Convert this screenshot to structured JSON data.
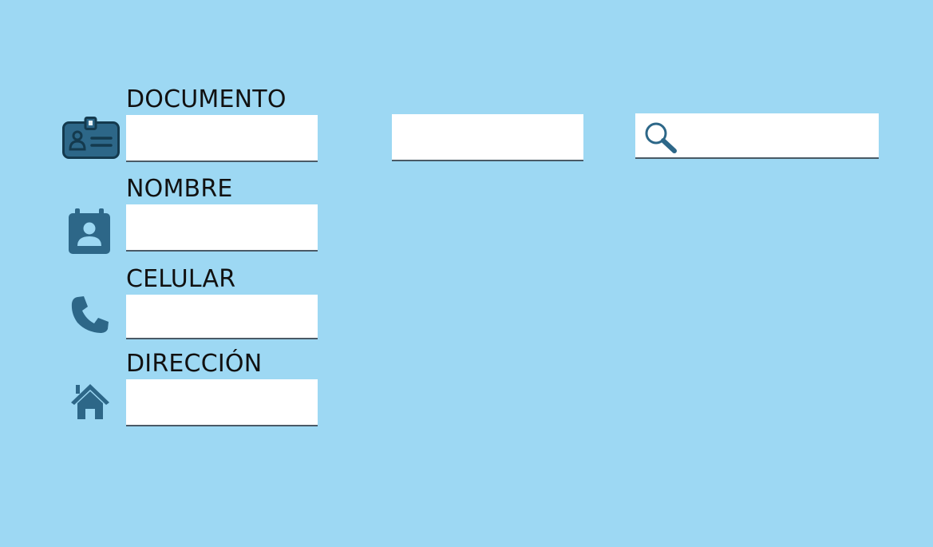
{
  "form": {
    "fields": [
      {
        "id": "documento",
        "label": "DOCUMENTO",
        "value": "",
        "icon": "id-badge-icon"
      },
      {
        "id": "nombre",
        "label": "NOMBRE",
        "value": "",
        "icon": "contact-card-icon"
      },
      {
        "id": "celular",
        "label": "CELULAR",
        "value": "",
        "icon": "phone-icon"
      },
      {
        "id": "direccion",
        "label": "DIRECCIÓN",
        "value": "",
        "icon": "home-icon"
      }
    ],
    "secondary_field": {
      "value": ""
    },
    "search": {
      "value": "",
      "icon": "search-icon"
    }
  },
  "colors": {
    "background": "#9dd8f3",
    "icon": "#2d6788",
    "icon_dark": "#143a4e",
    "field": "#ffffff",
    "field_border": "#4a5a66"
  }
}
